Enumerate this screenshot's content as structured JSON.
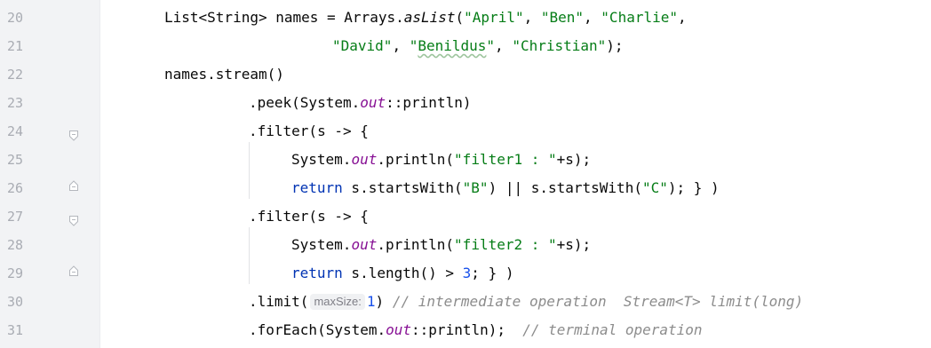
{
  "gutter": {
    "line_numbers": [
      "20",
      "21",
      "22",
      "23",
      "24",
      "25",
      "26",
      "27",
      "28",
      "29",
      "30",
      "31"
    ]
  },
  "code": {
    "l20": {
      "a": "List<String> names = Arrays.",
      "b": "asList",
      "c": "(",
      "d": "\"April\"",
      "e": ", ",
      "f": "\"Ben\"",
      "g": ", ",
      "h": "\"Charlie\"",
      "i": ","
    },
    "l21": {
      "a": "\"David\"",
      "b": ", ",
      "c": "\"",
      "d": "Benildus",
      "e": "\"",
      "f": ", ",
      "g": "\"Christian\"",
      "h": ");"
    },
    "l22": {
      "a": "names.stream()"
    },
    "l23": {
      "a": ".peek(System.",
      "b": "out",
      "c": "::println)"
    },
    "l24": {
      "a": ".filter(s -> {"
    },
    "l25": {
      "a": "System.",
      "b": "out",
      "c": ".println(",
      "d": "\"filter1 : \"",
      "e": "+s);"
    },
    "l26": {
      "a": "return",
      "b": " s.startsWith(",
      "c": "\"B\"",
      "d": ") || s.startsWith(",
      "e": "\"C\"",
      "f": "); } )"
    },
    "l27": {
      "a": ".filter(s -> {"
    },
    "l28": {
      "a": "System.",
      "b": "out",
      "c": ".println(",
      "d": "\"filter2 : \"",
      "e": "+s);"
    },
    "l29": {
      "a": "return",
      "b": " s.length() > ",
      "c": "3",
      "d": "; } )"
    },
    "l30": {
      "a": ".limit(",
      "hint": "maxSize:",
      "b": "1",
      "c": ") ",
      "d": "// intermediate operation  Stream<T> limit(long)"
    },
    "l31": {
      "a": ".forEach(System.",
      "b": "out",
      "c": "::println);  ",
      "d": "// terminal operation"
    }
  },
  "colors": {
    "string": "#067d17",
    "keyword": "#0033b3",
    "number": "#1750eb",
    "field": "#871094",
    "comment": "#8c8c8c",
    "gutter_bg": "#f2f3f5"
  },
  "icons": [
    "fold-collapse-icon",
    "fold-end-icon"
  ]
}
